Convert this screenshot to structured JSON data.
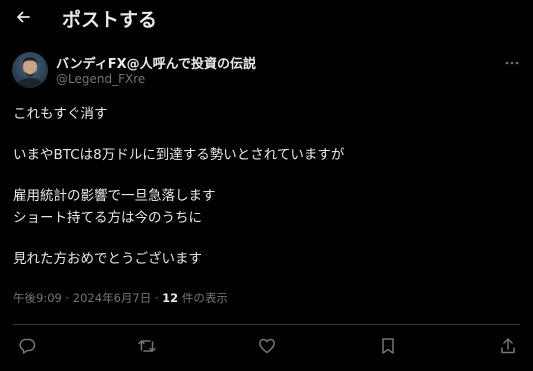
{
  "header": {
    "title": "ポストする",
    "back_icon": "arrow-left-icon"
  },
  "author": {
    "display_name": "バンディFX@人呼んで投資の伝説",
    "handle": "@Legend_FXre",
    "more_icon": "more-horizontal-icon"
  },
  "tweet": {
    "lines": [
      "これもすぐ消す",
      "",
      "いまやBTCは8万ドルに到達する勢いとされていますが",
      "",
      "雇用統計の影響で一旦急落します",
      "ショート持てる方は今のうちに",
      "",
      "見れた方おめでとうございます"
    ]
  },
  "meta": {
    "time": "午後9:09",
    "separator": "·",
    "date": "2024年6月7日",
    "views_count": "12",
    "views_label": "件の表示"
  },
  "actions": {
    "reply": "reply-icon",
    "repost": "repost-icon",
    "like": "like-icon",
    "bookmark": "bookmark-icon",
    "share": "share-icon"
  },
  "colors": {
    "background": "#000000",
    "text": "#e7e9ea",
    "secondary": "#71767b",
    "divider": "#2f3336"
  }
}
